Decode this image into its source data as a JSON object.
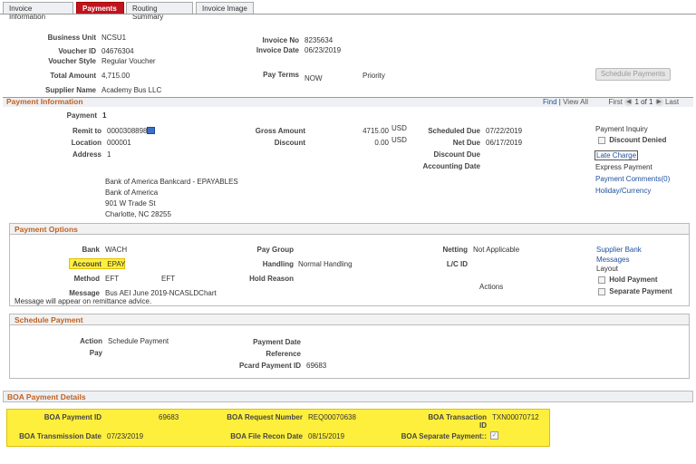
{
  "tabs": [
    "Invoice Information",
    "Payments",
    "Routing Summary",
    "Invoice Image"
  ],
  "header": {
    "business_unit_label": "Business Unit",
    "business_unit": "NCSU1",
    "voucher_id_label": "Voucher ID",
    "voucher_id": "04676304",
    "voucher_style_label": "Voucher Style",
    "voucher_style": "Regular Voucher",
    "total_amount_label": "Total Amount",
    "total_amount": "4,715.00",
    "supplier_name_label": "Supplier Name",
    "supplier_name": "Academy Bus LLC",
    "invoice_no_label": "Invoice No",
    "invoice_no": "8235634",
    "invoice_date_label": "Invoice Date",
    "invoice_date": "06/23/2019",
    "pay_terms_label": "Pay Terms",
    "pay_terms": "NOW",
    "priority_label": "Priority",
    "schedule_payments_btn": "Schedule Payments"
  },
  "payment_info": {
    "title": "Payment Information",
    "find": "Find",
    "view_all": "View All",
    "first": "First",
    "paging": "1 of 1",
    "last": "Last",
    "payment_label": "Payment",
    "payment": "1",
    "remit_to_label": "Remit to",
    "remit_to": "0000308898",
    "location_label": "Location",
    "location": "000001",
    "address_label": "Address",
    "address": "1",
    "gross_amount_label": "Gross Amount",
    "gross_amount": "4715.00",
    "gross_currency": "USD",
    "discount_label": "Discount",
    "discount": "0.00",
    "discount_currency": "USD",
    "scheduled_due_label": "Scheduled Due",
    "scheduled_due": "07/22/2019",
    "net_due_label": "Net Due",
    "net_due": "06/17/2019",
    "discount_due_label": "Discount Due",
    "accounting_date_label": "Accounting Date",
    "addr_lines": [
      "Bank of America Bankcard - EPAYABLES",
      "Bank of America",
      "901 W Trade St",
      "Charlotte, NC  28255"
    ],
    "side": {
      "payment_inquiry": "Payment Inquiry",
      "discount_denied": "Discount Denied",
      "late_charge": "Late Charge",
      "express_payment": "Express Payment",
      "payment_comments": "Payment Comments(0)",
      "holiday_currency": "Holiday/Currency"
    }
  },
  "payment_options": {
    "title": "Payment Options",
    "bank_label": "Bank",
    "bank": "WACH",
    "account_label": "Account",
    "account": "EPAY",
    "method_label": "Method",
    "method": "EFT",
    "method_desc": "EFT",
    "message_label": "Message",
    "message": "Bus AEI June 2019-NCASLDChart",
    "message_note": "Message will appear on remittance advice.",
    "pay_group_label": "Pay Group",
    "handling_label": "Handling",
    "handling": "Normal Handling",
    "hold_reason_label": "Hold Reason",
    "netting_label": "Netting",
    "netting": "Not Applicable",
    "lc_id_label": "L/C ID",
    "actions": "Actions",
    "supplier_bank": "Supplier Bank",
    "messages": "Messages",
    "layout": "Layout",
    "hold_payment": "Hold Payment",
    "separate_payment": "Separate Payment"
  },
  "schedule_payment": {
    "title": "Schedule Payment",
    "action_label": "Action",
    "action": "Schedule Payment",
    "pay_label": "Pay",
    "payment_date_label": "Payment Date",
    "reference_label": "Reference",
    "pcard_label": "Pcard Payment ID",
    "pcard": "69683"
  },
  "boa": {
    "title": "BOA Payment Details",
    "payment_id_label": "BOA Payment ID",
    "payment_id": "69683",
    "request_number_label": "BOA Request Number",
    "request_number": "REQ00070638",
    "transaction_label_1": "BOA Transaction",
    "transaction_label_2": "ID",
    "transaction": "TXN00070712",
    "transmission_date_label": "BOA Transmission Date",
    "transmission_date": "07/23/2019",
    "file_recon_label": "BOA File Recon Date",
    "file_recon": "08/15/2019",
    "separate_payment_label": "BOA Separate Payment::",
    "separate_payment_check": "✓"
  }
}
